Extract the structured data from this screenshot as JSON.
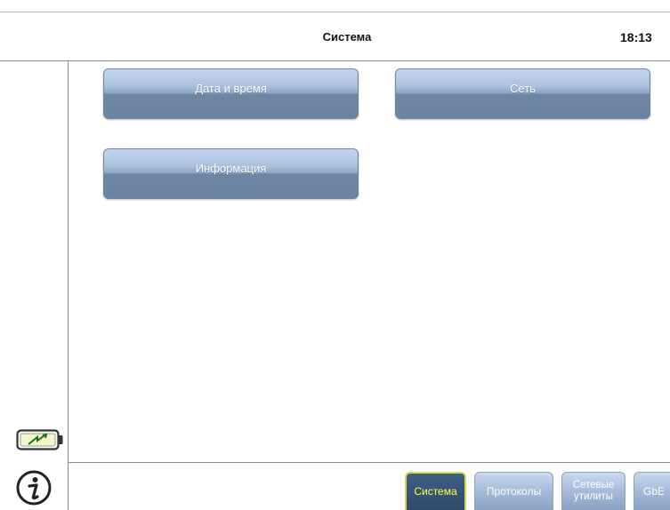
{
  "header": {
    "title": "Система",
    "clock": "18:13"
  },
  "menu": {
    "date_time": "Дата и время",
    "network": "Сеть",
    "info": "Информация"
  },
  "tabs": [
    {
      "label": "Система",
      "active": true
    },
    {
      "label": "Протоколы",
      "active": false
    },
    {
      "label": "Сетевые утилиты",
      "active": false
    },
    {
      "label": "GbE",
      "active": false
    }
  ],
  "icons": {
    "battery": "battery-charging-icon",
    "info": "info-icon"
  },
  "colors": {
    "button_top": "#c2d5ec",
    "button_bottom": "#6a84a2",
    "active_tab": "#2f4a6c",
    "active_text": "#ffff44"
  }
}
